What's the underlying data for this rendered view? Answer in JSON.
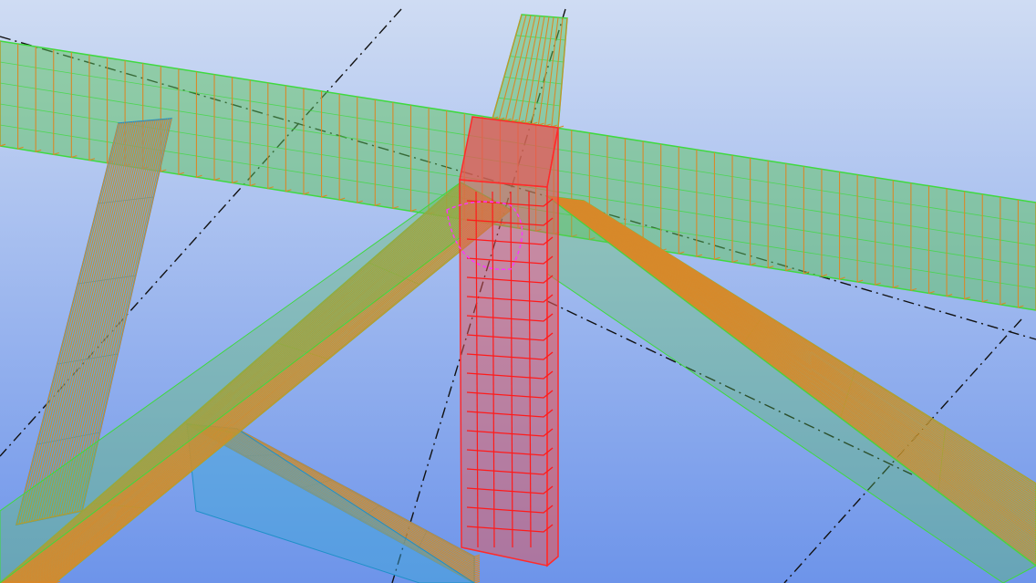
{
  "viewport": {
    "background_top": "#cfdcf3",
    "background_bottom": "#6d94ea"
  },
  "colors": {
    "beam_fill": "#5cc45c",
    "beam_edge": "#3fd93f",
    "column_fill": "#e85555",
    "column_edge": "#ff2a2a",
    "column_rebar": "#ff1a1a",
    "brace_fill": "#3aa6d8",
    "brace_edge": "#1e90c8",
    "stirrup": "#d7892a",
    "long_bar": "#2f8fd0",
    "gridline": "#111111",
    "connection_hint": "#ff33ff"
  },
  "elements": [
    {
      "kind": "beam",
      "name": "beam-main-horizontal"
    },
    {
      "kind": "beam",
      "name": "beam-top-right-stub"
    },
    {
      "kind": "beam",
      "name": "beam-diagonal-left"
    },
    {
      "kind": "beam",
      "name": "beam-diagonal-right"
    },
    {
      "kind": "column",
      "name": "column-center"
    },
    {
      "kind": "brace",
      "name": "brace-left-vertical"
    },
    {
      "kind": "brace",
      "name": "brace-bottom"
    }
  ]
}
